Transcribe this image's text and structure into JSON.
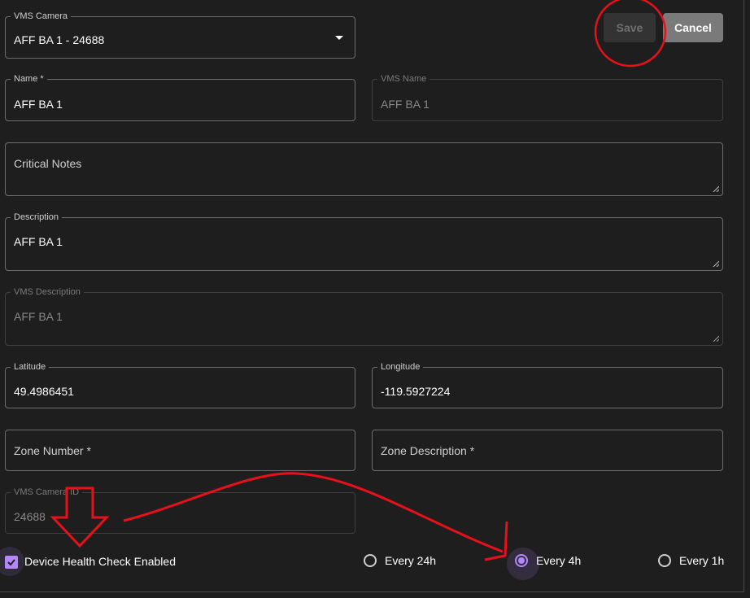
{
  "actions": {
    "save_label": "Save",
    "cancel_label": "Cancel"
  },
  "fields": {
    "vms_camera": {
      "label": "VMS Camera",
      "value": "AFF BA 1 - 24688"
    },
    "name": {
      "label": "Name *",
      "value": "AFF BA 1"
    },
    "vms_name": {
      "label": "VMS Name",
      "value": "AFF BA 1"
    },
    "critical_notes": {
      "placeholder": "Critical Notes"
    },
    "description": {
      "label": "Description",
      "value": "AFF BA 1"
    },
    "vms_description": {
      "label": "VMS Description",
      "value": "AFF BA 1"
    },
    "latitude": {
      "label": "Latitude",
      "value": "49.4986451"
    },
    "longitude": {
      "label": "Longitude",
      "value": "-119.5927224"
    },
    "zone_number": {
      "placeholder": "Zone Number *"
    },
    "zone_description": {
      "placeholder": "Zone Description *"
    },
    "vms_camera_id": {
      "label": "VMS Camera ID",
      "value": "24688"
    }
  },
  "health_check": {
    "label": "Device Health Check Enabled",
    "checked": true,
    "intervals": [
      {
        "label": "Every 24h",
        "selected": false
      },
      {
        "label": "Every 4h",
        "selected": true
      },
      {
        "label": "Every 1h",
        "selected": false
      }
    ]
  },
  "colors": {
    "background": "#1e1e1e",
    "accent": "#b388ff",
    "annotation": "#e8101a",
    "border": "#6e6e6e",
    "disabled_text": "#888888"
  }
}
